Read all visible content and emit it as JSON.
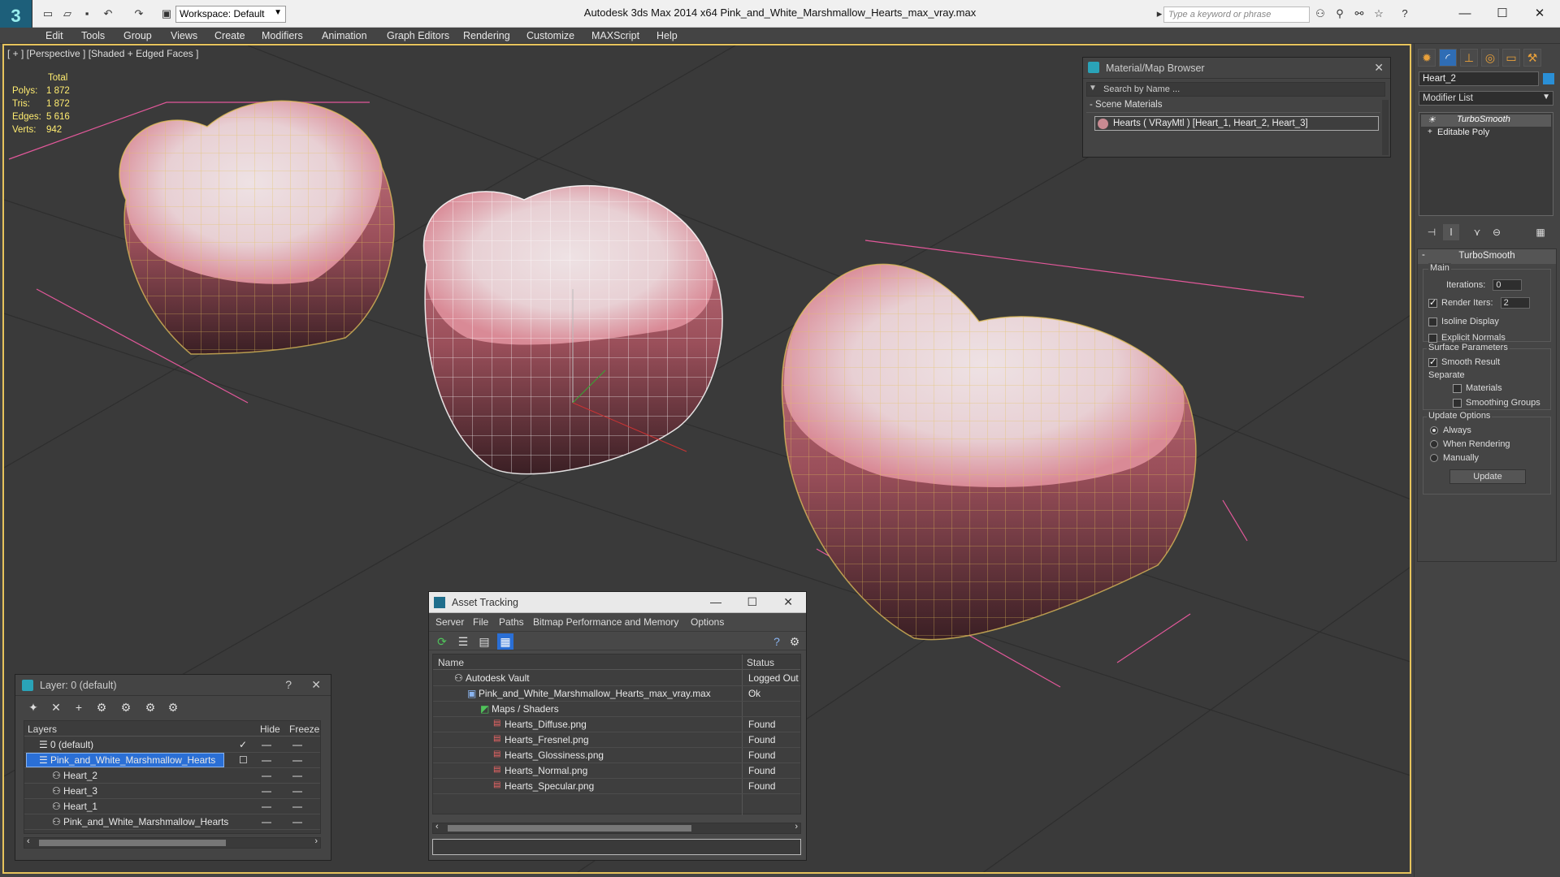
{
  "app": {
    "title": "Autodesk 3ds Max  2014 x64     Pink_and_White_Marshmallow_Hearts_max_vray.max",
    "workspace": "Workspace: Default",
    "search_placeholder": "Type a keyword or phrase",
    "logo_glyph": "3"
  },
  "menu": [
    "Edit",
    "Tools",
    "Group",
    "Views",
    "Create",
    "Modifiers",
    "Animation",
    "Graph Editors",
    "Rendering",
    "Customize",
    "MAXScript",
    "Help"
  ],
  "viewport": {
    "label": "[ + ] [Perspective ] [Shaded + Edged Faces ]",
    "stats": [
      {
        "label": "Total",
        "value": ""
      },
      {
        "label": "Polys:",
        "value": "1 872"
      },
      {
        "label": "Tris:",
        "value": "1 872"
      },
      {
        "label": "Edges:",
        "value": "5 616"
      },
      {
        "label": "Verts:",
        "value": "942"
      }
    ]
  },
  "material_browser": {
    "title": "Material/Map Browser",
    "search_placeholder": "Search by Name ...",
    "section": "- Scene Materials",
    "item": "Hearts  ( VRayMtl ) [Heart_1, Heart_2, Heart_3]"
  },
  "command_panel": {
    "object_name": "Heart_2",
    "modifier_list": "Modifier List",
    "stack": [
      "TurboSmooth",
      "Editable Poly"
    ],
    "rollout_title": "TurboSmooth",
    "main_label": "Main",
    "iterations_label": "Iterations:",
    "iterations_value": "0",
    "render_iters_label": "Render Iters:",
    "render_iters_value": "2",
    "isoline": "Isoline Display",
    "explicit_normals": "Explicit Normals",
    "surface_params": "Surface Parameters",
    "smooth_result": "Smooth Result",
    "separate": "Separate",
    "materials": "Materials",
    "smoothing_groups": "Smoothing Groups",
    "update_options": "Update Options",
    "always": "Always",
    "when_rendering": "When Rendering",
    "manually": "Manually",
    "update_button": "Update"
  },
  "layer_panel": {
    "title": "Layer: 0 (default)",
    "col_layers": "Layers",
    "col_hide": "Hide",
    "col_freeze": "Freeze",
    "rows": [
      "0 (default)",
      "Pink_and_White_Marshmallow_Hearts",
      "Heart_2",
      "Heart_3",
      "Heart_1",
      "Pink_and_White_Marshmallow_Hearts"
    ]
  },
  "asset_tracking": {
    "title": "Asset Tracking",
    "menu": [
      "Server",
      "File",
      "Paths",
      "Bitmap Performance and Memory",
      "Options"
    ],
    "col_name": "Name",
    "col_status": "Status",
    "rows": [
      {
        "name": "Autodesk Vault",
        "status": "Logged Out ..."
      },
      {
        "name": "Pink_and_White_Marshmallow_Hearts_max_vray.max",
        "status": "Ok"
      },
      {
        "name": "Maps / Shaders",
        "status": ""
      },
      {
        "name": "Hearts_Diffuse.png",
        "status": "Found"
      },
      {
        "name": "Hearts_Fresnel.png",
        "status": "Found"
      },
      {
        "name": "Hearts_Glossiness.png",
        "status": "Found"
      },
      {
        "name": "Hearts_Normal.png",
        "status": "Found"
      },
      {
        "name": "Hearts_Specular.png",
        "status": "Found"
      }
    ]
  },
  "colors": {
    "viewport_border": "#e6c35c",
    "selection": "#2a6fd6",
    "stats_text": "#ffec70",
    "marshmallow_pink": "#d88a94"
  }
}
